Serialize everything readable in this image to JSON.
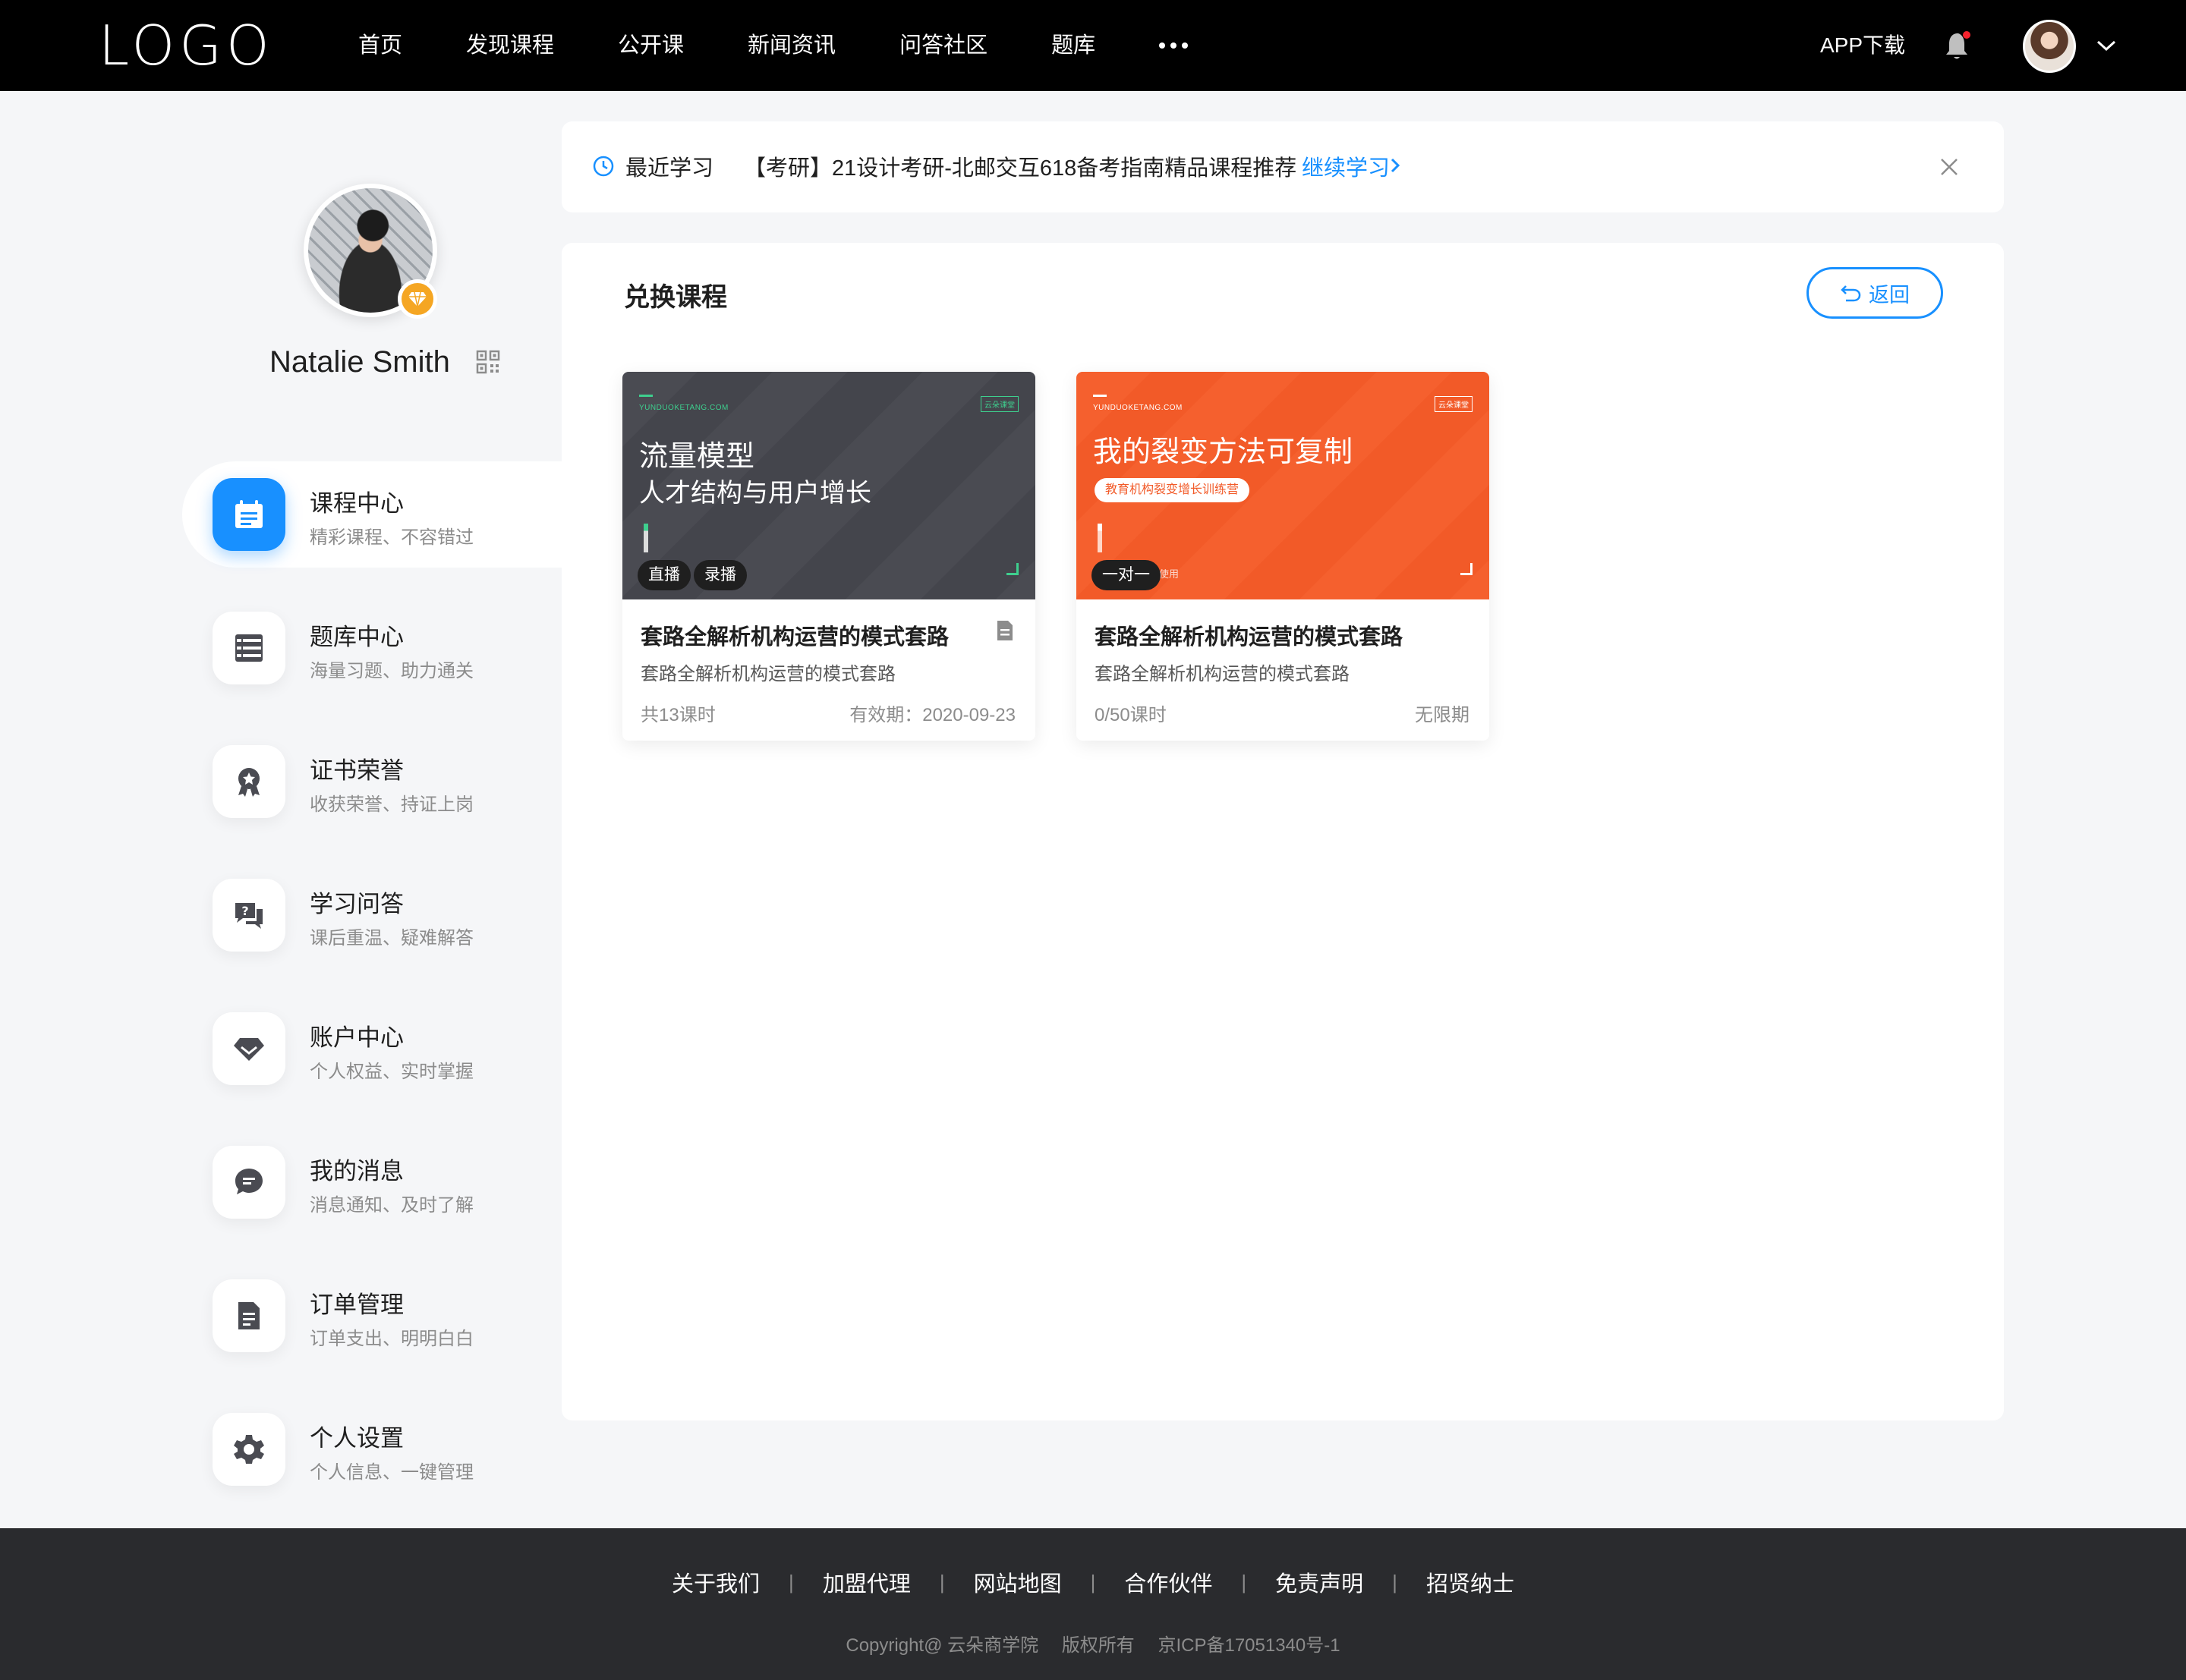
{
  "header": {
    "logo": "LOGO",
    "nav": [
      "首页",
      "发现课程",
      "公开课",
      "新闻资讯",
      "问答社区",
      "题库"
    ],
    "app_download": "APP下载",
    "notification_dot_color": "#f5222d"
  },
  "profile": {
    "name": "Natalie Smith"
  },
  "sidebar": {
    "items": [
      {
        "title": "课程中心",
        "sub": "精彩课程、不容错过",
        "icon": "calendar-icon",
        "active": true
      },
      {
        "title": "题库中心",
        "sub": "海量习题、助力通关",
        "icon": "list-icon",
        "active": false
      },
      {
        "title": "证书荣誉",
        "sub": "收获荣誉、持证上岗",
        "icon": "award-icon",
        "active": false
      },
      {
        "title": "学习问答",
        "sub": "课后重温、疑难解答",
        "icon": "question-chat-icon",
        "active": false
      },
      {
        "title": "账户中心",
        "sub": "个人权益、实时掌握",
        "icon": "diamond-icon",
        "active": false
      },
      {
        "title": "我的消息",
        "sub": "消息通知、及时了解",
        "icon": "message-icon",
        "active": false
      },
      {
        "title": "订单管理",
        "sub": "订单支出、明明白白",
        "icon": "document-icon",
        "active": false
      },
      {
        "title": "个人设置",
        "sub": "个人信息、一键管理",
        "icon": "gear-icon",
        "active": false
      }
    ]
  },
  "recent": {
    "label": "最近学习",
    "course": "【考研】21设计考研-北邮交互618备考指南精品课程推荐",
    "continue": "继续学习"
  },
  "panel": {
    "title": "兑换课程",
    "back": "返回",
    "cards": [
      {
        "theme": "dark",
        "site": "YUNDUOKETANG.COM",
        "brand": "云朵课堂",
        "headline1": "流量模型",
        "headline2": "人才结构与用户增长",
        "tags": [
          "直播",
          "录播"
        ],
        "title": "套路全解析机构运营的模式套路",
        "desc": "套路全解析机构运营的模式套路",
        "lessons": "共13课时",
        "valid": "有效期：2020-09-23"
      },
      {
        "theme": "orange",
        "site": "YUNDUOKETANG.COM",
        "brand": "云朵课堂",
        "headline1": "我的裂变方法可复制",
        "pill": "教育机构裂变增长训练营",
        "fine": "例使用",
        "tags": [
          "一对一"
        ],
        "title": "套路全解析机构运营的模式套路",
        "desc": "套路全解析机构运营的模式套路",
        "lessons": "0/50课时",
        "valid": "无限期"
      }
    ]
  },
  "footer": {
    "links": [
      "关于我们",
      "加盟代理",
      "网站地图",
      "合作伙伴",
      "免责声明",
      "招贤纳士"
    ],
    "copyright": "Copyright@ 云朵商学院",
    "rights": "版权所有",
    "icp": "京ICP备17051340号-1"
  },
  "colors": {
    "accent": "#1890ff",
    "header_bg": "#000000",
    "footer_bg": "#2a2b2e",
    "vip_badge": "#f5a623",
    "card_dark": "#4a4b52",
    "card_orange": "#f5602e"
  }
}
